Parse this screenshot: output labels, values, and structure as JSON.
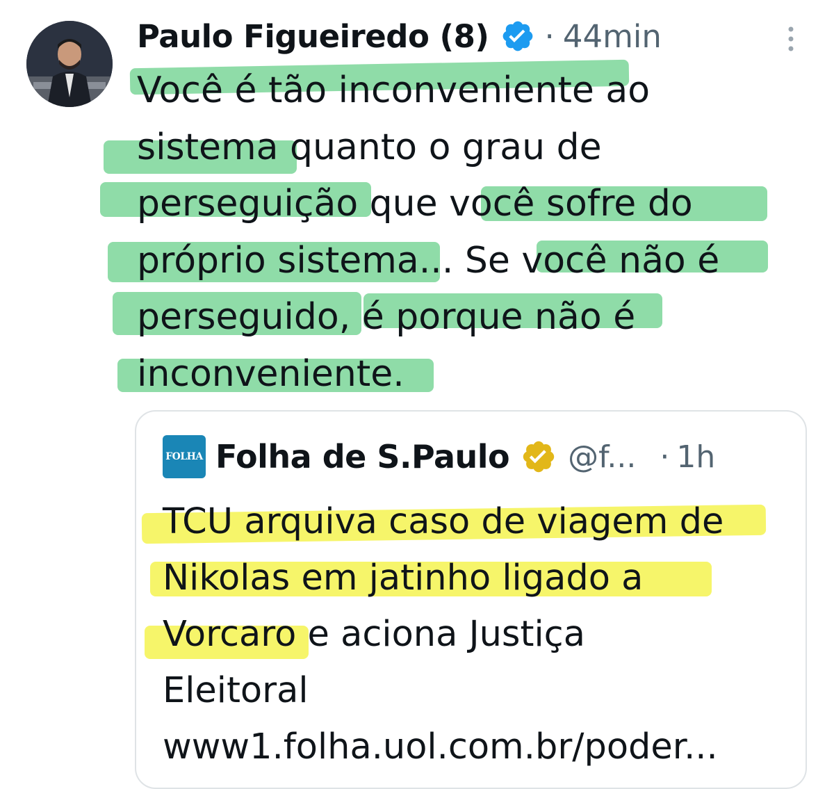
{
  "tweet": {
    "author": "Paulo Figueiredo (8)",
    "separator": "·",
    "time": "44min",
    "text_lines": [
      "Você é tão inconveniente ao",
      "sistema quanto o grau de",
      "perseguição que você sofre do",
      "próprio sistema... Se você não é",
      "perseguido, é porque não é",
      "inconveniente."
    ],
    "highlight_color": "#8fdca8"
  },
  "quote": {
    "logo_text": "FOLHA",
    "author": "Folha de S.Paulo",
    "handle": "@f...",
    "separator": "·",
    "time": "1h",
    "text_lines": [
      "TCU arquiva caso de viagem de",
      "Nikolas em jatinho ligado a",
      "Vorcaro e aciona Justiça",
      "Eleitoral",
      "www1.folha.uol.com.br/poder..."
    ],
    "highlight_color": "#f6f56a"
  },
  "colors": {
    "verified_blue": "#1d9bf0",
    "verified_gold": "#e2b719",
    "muted_text": "#536471",
    "folha_blue": "#1a86b6"
  }
}
